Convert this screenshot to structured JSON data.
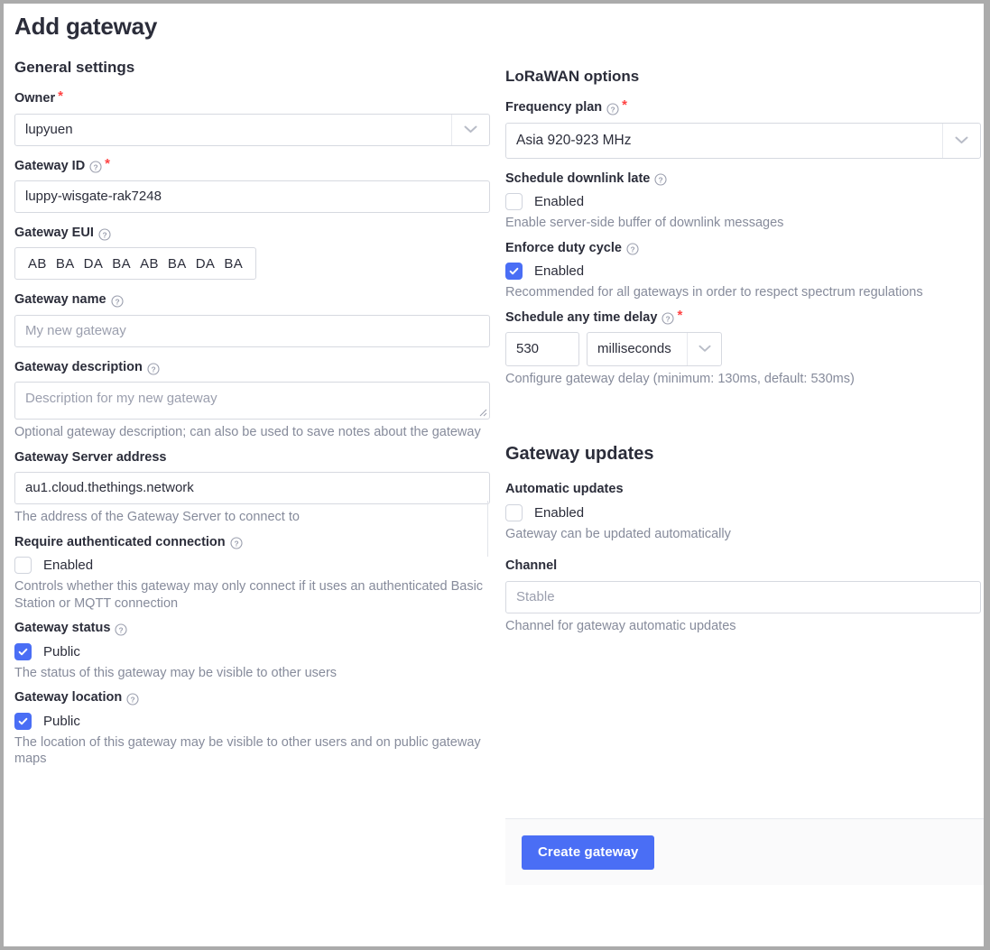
{
  "page": {
    "title": "Add gateway"
  },
  "general": {
    "heading": "General settings",
    "owner": {
      "label": "Owner",
      "required": true,
      "value": "lupyuen"
    },
    "gateway_id": {
      "label": "Gateway ID",
      "required": true,
      "has_help": true,
      "value": "luppy-wisgate-rak7248"
    },
    "gateway_eui": {
      "label": "Gateway EUI",
      "has_help": true,
      "pairs": [
        "AB",
        "BA",
        "DA",
        "BA",
        "AB",
        "BA",
        "DA",
        "BA"
      ]
    },
    "gateway_name": {
      "label": "Gateway name",
      "has_help": true,
      "placeholder": "My new gateway",
      "value": ""
    },
    "gateway_description": {
      "label": "Gateway description",
      "has_help": true,
      "placeholder": "Description for my new gateway",
      "value": "",
      "helper": "Optional gateway description; can also be used to save notes about the gateway"
    },
    "gateway_server_address": {
      "label": "Gateway Server address",
      "value": "au1.cloud.thethings.network",
      "helper": "The address of the Gateway Server to connect to"
    },
    "require_auth": {
      "label": "Require authenticated connection",
      "has_help": true,
      "checkbox_label": "Enabled",
      "checked": false,
      "helper": "Controls whether this gateway may only connect if it uses an authenticated Basic Station or MQTT connection"
    },
    "gateway_status": {
      "label": "Gateway status",
      "has_help": true,
      "checkbox_label": "Public",
      "checked": true,
      "helper": "The status of this gateway may be visible to other users"
    },
    "gateway_location": {
      "label": "Gateway location",
      "has_help": true,
      "checkbox_label": "Public",
      "checked": true,
      "helper": "The location of this gateway may be visible to other users and on public gateway maps"
    }
  },
  "lorawan": {
    "heading": "LoRaWAN options",
    "frequency_plan": {
      "label": "Frequency plan",
      "required": true,
      "has_help": true,
      "value": "Asia 920-923 MHz"
    },
    "schedule_downlink_late": {
      "label": "Schedule downlink late",
      "has_help": true,
      "checkbox_label": "Enabled",
      "checked": false,
      "helper": "Enable server-side buffer of downlink messages"
    },
    "enforce_duty_cycle": {
      "label": "Enforce duty cycle",
      "has_help": true,
      "checkbox_label": "Enabled",
      "checked": true,
      "helper": "Recommended for all gateways in order to respect spectrum regulations"
    },
    "schedule_any_time_delay": {
      "label": "Schedule any time delay",
      "required": true,
      "has_help": true,
      "value": "530",
      "unit": "milliseconds",
      "helper": "Configure gateway delay (minimum: 130ms, default: 530ms)"
    }
  },
  "updates": {
    "heading": "Gateway updates",
    "automatic_updates": {
      "label": "Automatic updates",
      "checkbox_label": "Enabled",
      "checked": false,
      "helper": "Gateway can be updated automatically"
    },
    "channel": {
      "label": "Channel",
      "placeholder": "Stable",
      "value": "",
      "helper": "Channel for gateway automatic updates"
    }
  },
  "footer": {
    "submit_label": "Create gateway"
  },
  "colors": {
    "accent": "#4a6ef5",
    "required_star": "#ff4242",
    "text": "#2b2d3a",
    "muted": "#868b9b",
    "border": "#d6d9e0",
    "footer_bg": "#fafafb",
    "frame": "#ababab"
  }
}
